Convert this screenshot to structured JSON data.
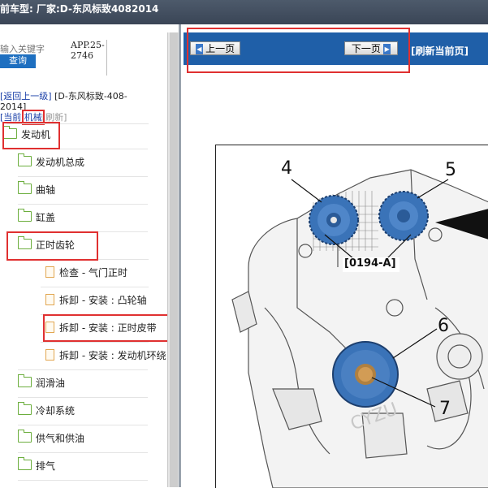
{
  "window": {
    "title": "前车型:  厂家:D-东风标致4082014"
  },
  "sidebar": {
    "search_placeholder": "输入关键字",
    "search_button": "查询",
    "app_code_line1": "APP.25-",
    "app_code_line2": "2746",
    "breadcrumb": {
      "back_link": "[返回上一级]",
      "path": "[D-东风标致-408-",
      "year": "2014]",
      "current_prefix": "[当前",
      "current_tab": "机械",
      "refresh": "[刷新]"
    },
    "tree": [
      {
        "label": "发动机",
        "type": "folder-open",
        "level": 0
      },
      {
        "label": "发动机总成",
        "type": "folder",
        "level": 1
      },
      {
        "label": "曲轴",
        "type": "folder",
        "level": 1
      },
      {
        "label": "缸盖",
        "type": "folder",
        "level": 1
      },
      {
        "label": "正时齿轮",
        "type": "folder-open",
        "level": 1
      },
      {
        "label": "检查 - 气门正时",
        "type": "doc",
        "level": 2
      },
      {
        "label": "拆卸 - 安装 : 凸轮轴",
        "type": "doc",
        "level": 2
      },
      {
        "label": "拆卸 - 安装 : 正时皮带",
        "type": "doc",
        "level": 2
      },
      {
        "label": "拆卸 - 安装 : 发动机环绕",
        "type": "doc",
        "level": 2
      },
      {
        "label": "润滑油",
        "type": "folder",
        "level": 1
      },
      {
        "label": "冷却系统",
        "type": "folder",
        "level": 1
      },
      {
        "label": "供气和供油",
        "type": "folder",
        "level": 1
      },
      {
        "label": "排气",
        "type": "folder",
        "level": 1
      }
    ]
  },
  "content": {
    "prev_button": "上一页",
    "next_button": "下一页",
    "refresh_button": "[刷新当前页]",
    "diagram": {
      "callouts": [
        "4",
        "5",
        "6",
        "7"
      ],
      "ref_label": "[0194-A]",
      "watermark": "CYZU"
    }
  },
  "colors": {
    "accent_blue": "#1f5fa8",
    "button_blue": "#1e6fc0",
    "highlight_red": "#e03030",
    "folder_green": "#6cae3e",
    "doc_orange": "#e2a650",
    "pulley_blue": "#3a73b8"
  }
}
